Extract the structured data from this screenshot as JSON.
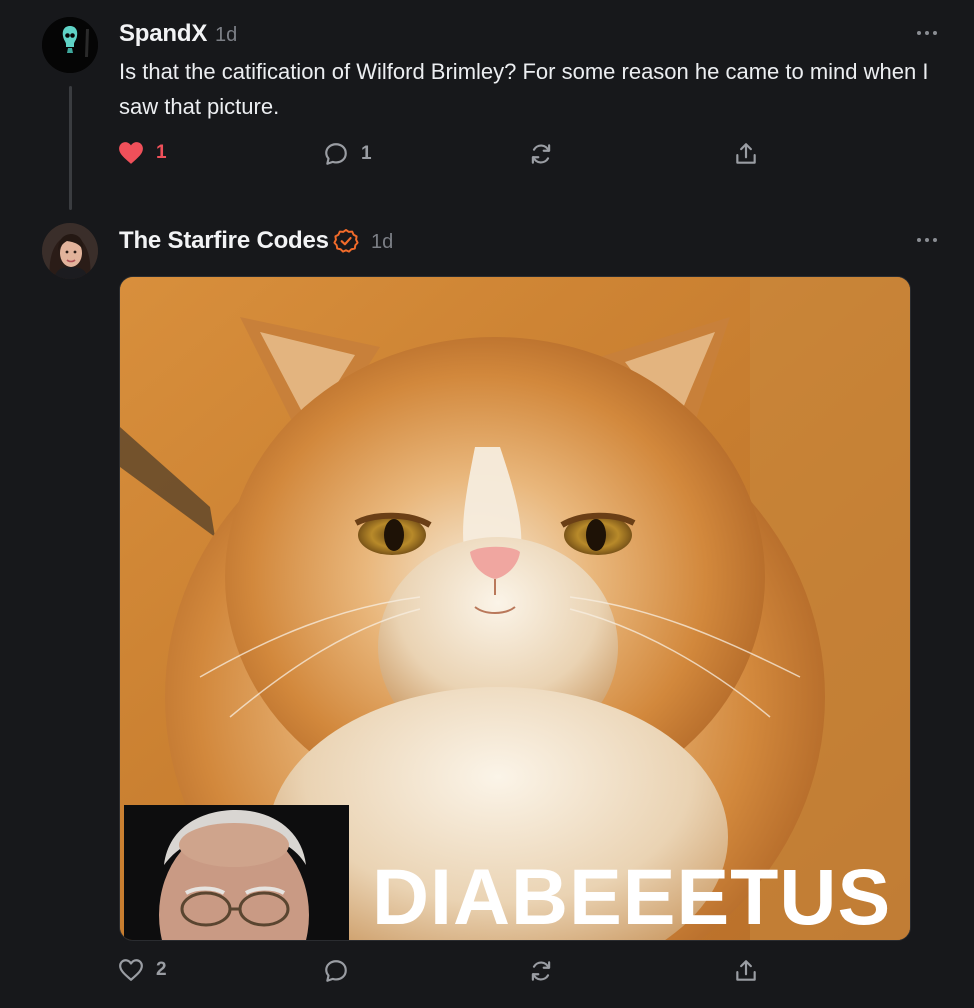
{
  "comments": [
    {
      "author": "SpandX",
      "time": "1d",
      "text": "Is that the catification of Wilford Brimley? For some reason he came to mind when I saw that picture.",
      "likes": "1",
      "replies": "1",
      "liked": true
    },
    {
      "author": "The Starfire Codes",
      "time": "1d",
      "verified": true,
      "media": {
        "caption": "DIABEEETUS"
      },
      "likes": "2"
    }
  ],
  "icons": {
    "like": "heart-icon",
    "reply": "comment-bubble-icon",
    "restack": "restack-icon",
    "share": "share-icon",
    "more": "more-dots-icon",
    "verified": "verified-check-icon"
  },
  "colors": {
    "background": "#17181b",
    "liked": "#f0505a",
    "verified": "#f26b2a",
    "muted": "#7c7f86"
  }
}
